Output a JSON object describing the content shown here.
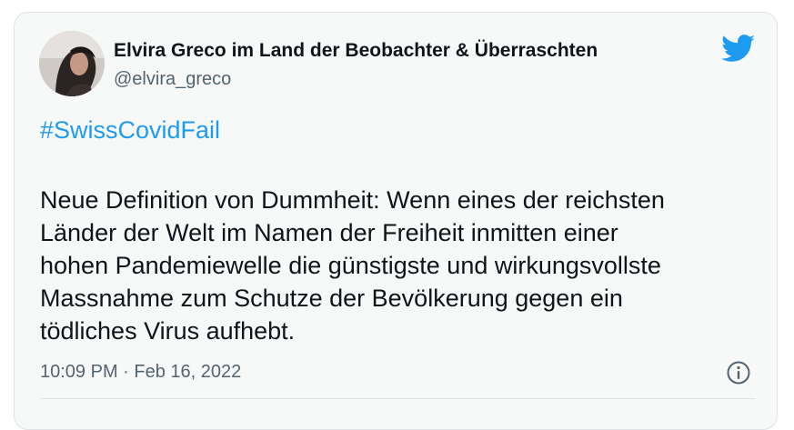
{
  "tweet": {
    "author": {
      "display_name": "Elvira Greco im Land der Beobachter & Überraschten",
      "handle": "@elvira_greco",
      "avatar": "profile-photo"
    },
    "hashtag": "#SwissCovidFail",
    "body_lines": [
      "Neue Definition von Dummheit: Wenn eines der reichsten",
      "Länder der Welt im Namen der Freiheit inmitten einer",
      "hohen Pandemiewelle die günstigste und wirkungsvollste",
      "Massnahme zum Schutze der Bevölkerung gegen ein",
      "tödliches Virus aufhebt."
    ],
    "timestamp": "10:09 PM · Feb 16, 2022",
    "icons": {
      "brand": "twitter-bird-icon",
      "info": "info-icon"
    }
  },
  "colors": {
    "accent": "#1d9bf0",
    "text": "#0f1419",
    "secondary_text": "#536471",
    "card_background": "#f7f9f9",
    "border": "#dfe3e6"
  }
}
